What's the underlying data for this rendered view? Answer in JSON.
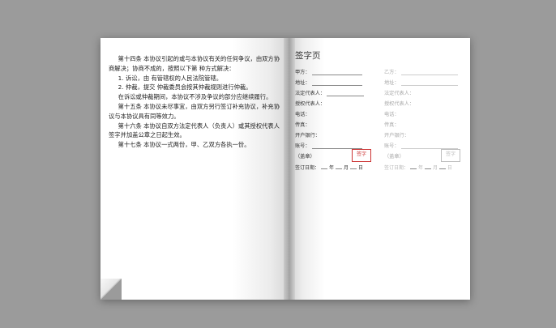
{
  "left_page": {
    "paragraphs": [
      {
        "text": "第十四条 本协议引起的或与本协议有关的任何争议，由双方协商解决；协商不成的，按照以下第 种方式解决：",
        "indent": true
      },
      {
        "text": "1. 诉讼，由 有管辖权的人民法院管辖。",
        "indent": true
      },
      {
        "text": "2. 仲裁，提交 仲裁委员会按其仲裁规则进行仲裁。",
        "indent": true
      },
      {
        "text": "在诉讼或仲裁期间，本协议不涉及争议的部分应继续履行。",
        "indent": true
      },
      {
        "text": "第十五条 本协议未尽事宜，由双方另行签订补充协议，补充协议与本协议具有同等效力。",
        "indent": true
      },
      {
        "text": "第十六条 本协议自双方法定代表人（负责人）或其授权代表人签字并加盖公章之日起生效。",
        "indent": true
      },
      {
        "text": "第十七条 本协议一式两份，甲、乙双方各执一份。",
        "indent": true
      }
    ]
  },
  "right_page": {
    "title": "签字页",
    "party_a": [
      {
        "label": "甲方："
      },
      {
        "label": "地址："
      },
      {
        "label": "法定代表人："
      },
      {
        "label": "授权代表人："
      },
      {
        "label": "电话："
      },
      {
        "label": "传真："
      },
      {
        "label": "开户银行："
      },
      {
        "label": "账号："
      }
    ],
    "party_b": [
      {
        "label": "乙方："
      },
      {
        "label": "地址："
      },
      {
        "label": "法定代表人："
      },
      {
        "label": "授权代表人："
      },
      {
        "label": "电话："
      },
      {
        "label": "传真："
      },
      {
        "label": "开户银行："
      },
      {
        "label": "账号："
      }
    ],
    "seal_label": "（盖章）",
    "stamp_text": "签字",
    "date_label": "签订日期：",
    "date_units": [
      "年",
      "月",
      "日"
    ]
  }
}
